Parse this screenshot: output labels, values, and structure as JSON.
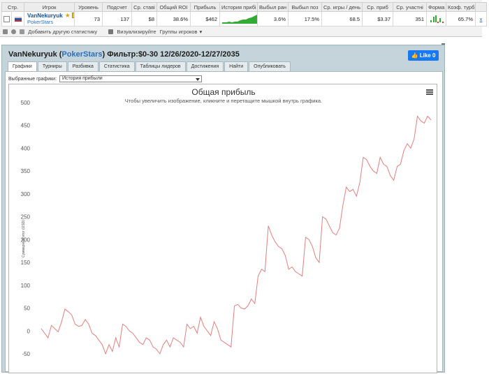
{
  "stats": {
    "headers": [
      "Стр.",
      "Игрок",
      "Уровень",
      "Подсчет",
      "Ср. ставі",
      "Общий ROI",
      "Прибыль",
      "История прибі",
      "Выбыл ран",
      "Выбыл поз",
      "Ср. игры / день",
      "Ср. приб",
      "Ср. участні",
      "Форма",
      "Коэф. турб",
      ""
    ],
    "row": {
      "player_name": "VanNekuryuk",
      "room": "PokerStars",
      "level": "73",
      "count": "137",
      "avg_stake": "$8",
      "total_roi": "38.6%",
      "profit": "$462",
      "early_out": "3.6%",
      "late_out": "17.5%",
      "games_per_day": "68.5",
      "avg_profit": "$3.37",
      "avg_entrants": "351",
      "turbo_coef": "65.7%",
      "x_link": "x"
    },
    "flag": "ru-flag",
    "colors": {
      "accent_green": "#33aa33",
      "form_red": "#dd3333"
    }
  },
  "toolbar": {
    "add_stats": "Добавить другую статистику",
    "visualize": "Визуализируйте",
    "player_groups": "Группы игроков"
  },
  "panel": {
    "title_prefix": "VanNekuryuk (",
    "title_room": "PokerStars",
    "title_suffix": ") Фильтр:$0-30 12/26/2020-12/27/2035",
    "fb_like": "Like 0"
  },
  "tabs": [
    "Графики",
    "Турниры",
    "Разбивка",
    "Статистика",
    "Таблицы лидеров",
    "Достижения",
    "Найти",
    "Опубликовать"
  ],
  "active_tab": "Графики",
  "chart_select": {
    "label": "Выбранные графики:",
    "value": "История прибыли"
  },
  "chart_data": {
    "type": "line",
    "title": "Общая прибыль",
    "subtitle": "Чтобы увеличить изображение, кликните и перетащите мышкой внутрь графика.",
    "ylabel": "Суммарный итог (USD)",
    "xlabel": "",
    "ylim": [
      -50,
      500
    ],
    "yticks": [
      500,
      450,
      400,
      350,
      300,
      250,
      200,
      150,
      100,
      50,
      0,
      -50
    ],
    "grid": false,
    "line_color": "#e08080",
    "series": [
      {
        "values": [
          5,
          -5,
          -15,
          12,
          5,
          -2,
          20,
          48,
          42,
          35,
          15,
          10,
          12,
          25,
          15,
          -5,
          -10,
          -20,
          -30,
          -50,
          -30,
          -45,
          -15,
          -35,
          15,
          10,
          0,
          -5,
          -15,
          -25,
          -30,
          -15,
          -20,
          -35,
          -40,
          -50,
          -30,
          -20,
          -35,
          -15,
          -20,
          -25,
          -35,
          15,
          5,
          10,
          -5,
          30,
          10,
          0,
          -10,
          20,
          5,
          -20,
          -25,
          -30,
          -35,
          55,
          58,
          50,
          48,
          55,
          70,
          60,
          120,
          135,
          130,
          230,
          210,
          195,
          185,
          180,
          165,
          135,
          140,
          130,
          125,
          120,
          205,
          200,
          185,
          160,
          150,
          250,
          245,
          230,
          215,
          210,
          225,
          275,
          315,
          305,
          310,
          295,
          325,
          380,
          375,
          360,
          350,
          345,
          380,
          365,
          360,
          340,
          330,
          360,
          365,
          395,
          410,
          400,
          420,
          470,
          460,
          455,
          470,
          462
        ]
      }
    ]
  }
}
